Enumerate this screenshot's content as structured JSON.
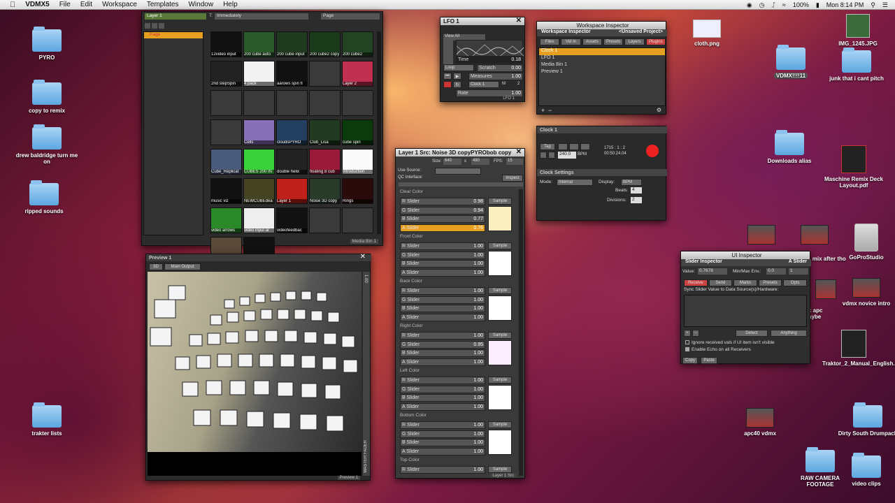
{
  "menubar": {
    "app": "VDMX5",
    "items": [
      "File",
      "Edit",
      "Workspace",
      "Templates",
      "Window",
      "Help"
    ],
    "battery": "100%",
    "clock": "Mon 8:14 PM"
  },
  "desktop": {
    "left": [
      "PYRO",
      "copy to remix",
      "drew baldridge turn me on",
      "ripped sounds",
      "trakter lists"
    ],
    "cloth": "cloth.png",
    "vdmx": "VDMX!!!!11",
    "img": "IMG_1245.JPG",
    "junk": "junk that i cant pitch",
    "downloads": "Downloads alias",
    "maschine": "Maschine Remix Deck Layout.pdf",
    "gopro": "GoProStudio",
    "vdmxnovice": "vdmx novice intro",
    "traktor": "Traktor_2_Manual_English.pdf",
    "apc40": "apc40 vdmx",
    "dirty": "Dirty South Drumpack",
    "raw": "RAW CAMERA FOOTAGE",
    "videoclips": "video clips",
    "goodmix": "good mix after tho",
    "apc": "x apc aybe"
  },
  "mediabin": {
    "layer": "Layer 1",
    "trigger": "Immediately",
    "page": "Page",
    "page_item": "Page",
    "footer": "Media Bin 1",
    "clips": [
      "12video input",
      "200 cube auto",
      "200 cube input",
      "200 cube2 copy",
      "200 cube2",
      "2nd stepSpin",
      "4 pack",
      "aarows spin fl",
      "",
      "Layer 2",
      "",
      "",
      "",
      "",
      "",
      "",
      "Cells",
      "cloudsPYRO",
      "Club_Lisa",
      "cube spin",
      "Cube_Replicat",
      "CUBES 200 IN",
      "double helix",
      "floating 8 cub",
      "Introduction",
      "music viz",
      "NEWCUBEdea",
      "Layer 1",
      "Noise 3D copy",
      "Rings",
      "video arrows",
      "video input ar",
      "videofeedbac",
      "",
      "",
      "nyc-subway",
      "bouncing ball"
    ],
    "red_label": "Noise 3D copy",
    "blue_label": "Blue"
  },
  "lfo": {
    "title": "LFO 1",
    "view": "View All",
    "time_label": "Time",
    "time": "0.18",
    "loop": "Loop",
    "scratch": "Scratch",
    "scratch_v": "0.00",
    "measures": "Measures",
    "measures_v": "1.00",
    "clock": "Clock 1",
    "m": "M",
    "m_v": "2",
    "rate": "Rate",
    "rate_v": "1.00",
    "footer": "LFO 1"
  },
  "workspace": {
    "title": "Workspace Inspector",
    "sub": "Workspace Inspector",
    "project": "<Unsaved Project>",
    "tabs": [
      "Files",
      "Vid In",
      "Assets",
      "Presets",
      "Layers",
      "Plugins"
    ],
    "items": [
      "Clock 1",
      "LFO 1",
      "Media Bin 1",
      "Preview 1"
    ]
  },
  "clock": {
    "title": "Clock 1",
    "tap": "Tap",
    "bpm": "240.0",
    "bpm_label": "BPM",
    "pos": "1715 : 1 : 2",
    "time": "00:50:24.04",
    "settings": "Clock Settings",
    "mode_label": "Mode:",
    "mode": "Internal",
    "display_label": "Display:",
    "display": "BPM",
    "beats_label": "Beats:",
    "beats": "4",
    "div_label": "Divisions:",
    "div": "2"
  },
  "layersrc": {
    "title": "Layer 1 Src: Noise 3D copyPYRObob copy",
    "size_label": "Size:",
    "w": "640",
    "x": "x",
    "h": "480",
    "fps_label": "FPS:",
    "fps": "15",
    "use_source": "Use Source:",
    "qc": "QC Interface:",
    "inspect": "Inspect",
    "sample": "Sample",
    "footer": "Layer 1 Src",
    "groups": [
      {
        "name": "Clear Color",
        "vals": [
          "0.98",
          "0.94",
          "0.77",
          "0.76"
        ]
      },
      {
        "name": "Front Color",
        "vals": [
          "1.00",
          "1.00",
          "1.00",
          "1.00"
        ]
      },
      {
        "name": "Back Color",
        "vals": [
          "1.00",
          "1.00",
          "1.00",
          "1.00"
        ]
      },
      {
        "name": "Right Color",
        "vals": [
          "1.00",
          "0.95",
          "1.00",
          "1.00"
        ]
      },
      {
        "name": "Left Color",
        "vals": [
          "1.00",
          "1.00",
          "1.00",
          "1.00"
        ]
      },
      {
        "name": "Bottom Color",
        "vals": [
          "1.00",
          "1.00",
          "1.00",
          "1.00"
        ]
      },
      {
        "name": "Top Color",
        "vals": [
          "1.00"
        ]
      }
    ],
    "labels": [
      "R Slider",
      "G Slider",
      "B Slider",
      "A Slider"
    ]
  },
  "preview": {
    "title": "Preview 1",
    "mode": "3D",
    "output": "Main Output",
    "fader": "MASTER FADER",
    "fader_v": "1.00",
    "footer": "Preview 1"
  },
  "uiinsp": {
    "title": "UI Inspector",
    "sub": "Slider Inspector",
    "target": "A Slider",
    "value_label": "Value:",
    "value": "0.7678",
    "minmax": "Min/Max Env.:",
    "min": "0.0",
    "max": "1",
    "tabs": [
      "Receive",
      "Send",
      "Marks",
      "Presets",
      "Opts"
    ],
    "sync": "Sync Slider Value to Data Source(s)/Hardware:",
    "detect": "Detect",
    "anything": "Anything",
    "opt1": "Ignore received vals if UI item isn't visible",
    "opt2": "Enable Echo on all Receivers",
    "copy": "Copy",
    "paste": "Paste"
  }
}
